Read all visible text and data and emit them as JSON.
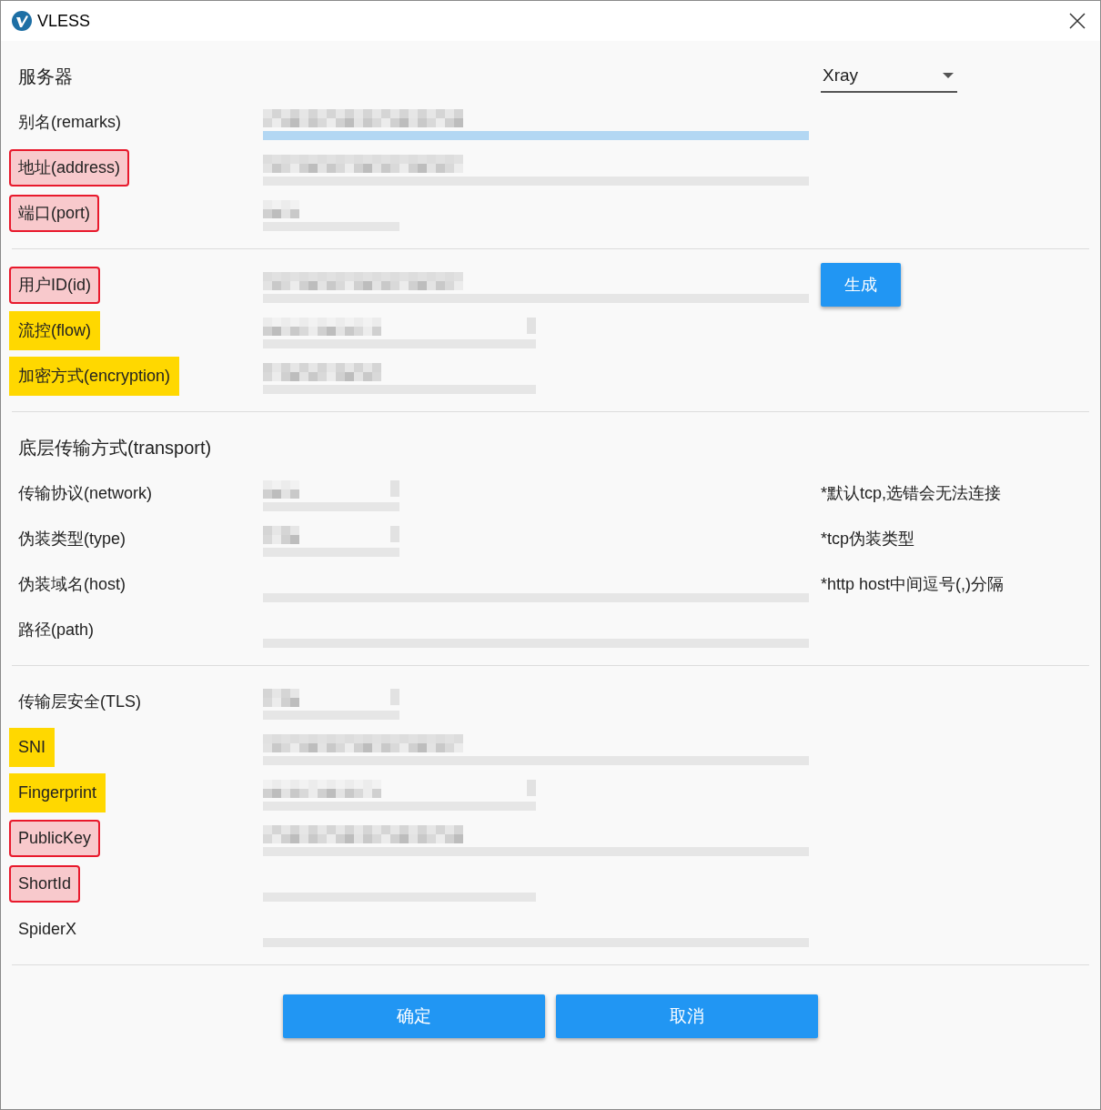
{
  "window": {
    "title": "VLESS"
  },
  "sections": [
    {
      "header": "服务器",
      "core_select": {
        "value": "Xray"
      },
      "rows": [
        {
          "label": "别名(remarks)",
          "field": {
            "kind": "wide",
            "filled": true,
            "focused": true
          }
        },
        {
          "label": "地址(address)",
          "color": "#f8c9cc",
          "outlined": true,
          "field": {
            "kind": "wide",
            "filled": true,
            "focused": false
          }
        },
        {
          "label": "端口(port)",
          "color": "#f8c9cc",
          "outlined": true,
          "field": {
            "kind": "short",
            "filled": true,
            "focused": false
          }
        }
      ]
    },
    {
      "rows": [
        {
          "label": "用户ID(id)",
          "color": "#f8c9cc",
          "outlined": true,
          "field": {
            "kind": "wide",
            "filled": true,
            "focused": false
          },
          "button": "生成"
        },
        {
          "label": "流控(flow)",
          "color": "#ffd800",
          "outlined": false,
          "field": {
            "kind": "halfselect",
            "filled": true,
            "focused": false
          }
        },
        {
          "label": "加密方式(encryption)",
          "color": "#ffd800",
          "outlined": false,
          "field": {
            "kind": "half",
            "filled": true,
            "focused": false
          }
        }
      ]
    },
    {
      "header": "底层传输方式(transport)",
      "rows": [
        {
          "label": "传输协议(network)",
          "field": {
            "kind": "shortselect",
            "filled": true,
            "focused": false
          },
          "note": "*默认tcp,选错会无法连接"
        },
        {
          "label": "伪装类型(type)",
          "field": {
            "kind": "shortselect",
            "filled": true,
            "focused": false
          },
          "note": "*tcp伪装类型"
        },
        {
          "label": "伪装域名(host)",
          "field": {
            "kind": "wide",
            "filled": false,
            "focused": false
          },
          "note": "*http host中间逗号(,)分隔"
        },
        {
          "label": "路径(path)",
          "field": {
            "kind": "wide",
            "filled": false,
            "focused": false
          }
        }
      ]
    },
    {
      "rows": [
        {
          "label": "传输层安全(TLS)",
          "field": {
            "kind": "shortselect",
            "filled": true,
            "focused": false
          }
        },
        {
          "label": "SNI",
          "color": "#ffd800",
          "outlined": false,
          "field": {
            "kind": "wide",
            "filled": true,
            "focused": false
          }
        },
        {
          "label": "Fingerprint",
          "color": "#ffd800",
          "outlined": false,
          "field": {
            "kind": "halfselect",
            "filled": true,
            "focused": false
          }
        },
        {
          "label": "PublicKey",
          "color": "#f8c9cc",
          "outlined": true,
          "field": {
            "kind": "wide",
            "filled": true,
            "focused": false
          }
        },
        {
          "label": "ShortId",
          "color": "#f8c9cc",
          "outlined": true,
          "field": {
            "kind": "half",
            "filled": false,
            "focused": false
          }
        },
        {
          "label": "SpiderX",
          "field": {
            "kind": "wide",
            "filled": false,
            "focused": false
          }
        }
      ]
    }
  ],
  "buttons": [
    "确定",
    "取消"
  ]
}
